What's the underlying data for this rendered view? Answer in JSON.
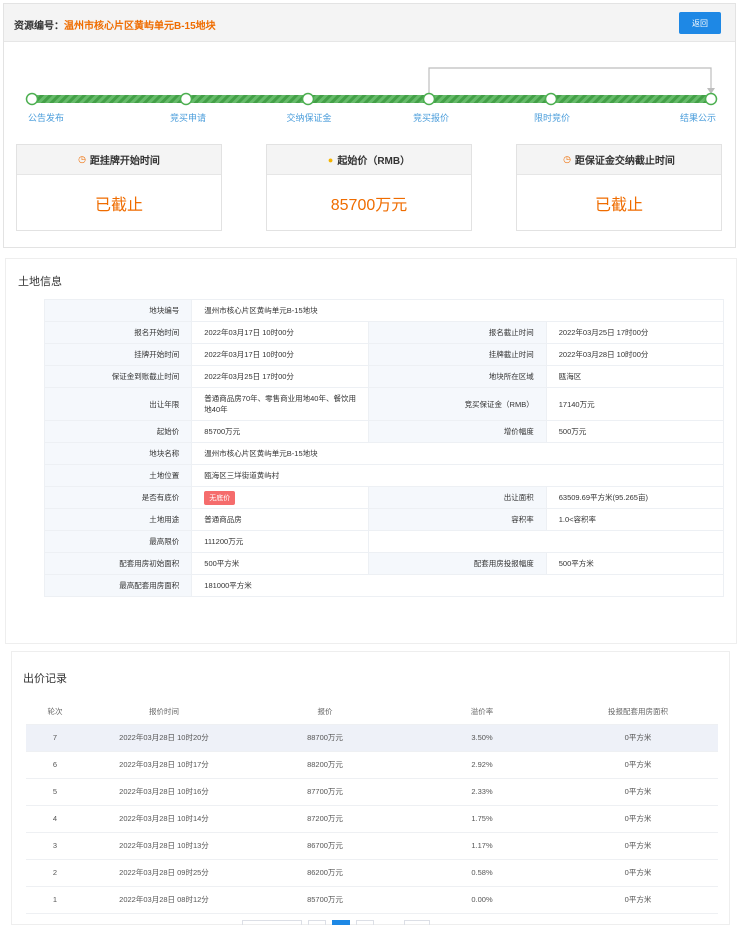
{
  "header": {
    "label": "资源编号：",
    "code": "温州市核心片区黄屿单元B-15地块",
    "back_label": "返回"
  },
  "steps": [
    {
      "label": "公告发布"
    },
    {
      "label": "竞买申请"
    },
    {
      "label": "交纳保证金"
    },
    {
      "label": "竞买报价"
    },
    {
      "label": "限时竞价"
    },
    {
      "label": "结果公示"
    }
  ],
  "cards": [
    {
      "title": "距挂牌开始时间",
      "value": "已截止",
      "icon": "clock-icon"
    },
    {
      "title": "起始价（RMB）",
      "value": "85700万元",
      "icon": "coin-icon"
    },
    {
      "title": "距保证金交纳截止时间",
      "value": "已截止",
      "icon": "clock-icon"
    }
  ],
  "land": {
    "title": "土地信息",
    "rows": {
      "r1": {
        "k": "地块编号",
        "v": "温州市核心片区黄屿单元B-15地块"
      },
      "r2": {
        "k": "报名开始时间",
        "v": "2022年03月17日 10时00分",
        "k2": "报名截止时间",
        "v2": "2022年03月25日 17时00分"
      },
      "r3": {
        "k": "挂牌开始时间",
        "v": "2022年03月17日 10时00分",
        "k2": "挂牌截止时间",
        "v2": "2022年03月28日 10时00分"
      },
      "r4": {
        "k": "保证金到账截止时间",
        "v": "2022年03月25日 17时00分",
        "k2": "地块所在区域",
        "v2": "瓯海区"
      },
      "r5": {
        "k": "出让年限",
        "v": "普通商品房70年、零售商业用地40年、餐饮用地40年",
        "k2": "竞买保证金（RMB）",
        "v2": "17140万元"
      },
      "r6": {
        "k": "起始价",
        "v": "85700万元",
        "k2": "增价幅度",
        "v2": "500万元"
      },
      "r7": {
        "k": "地块名称",
        "v": "温州市核心片区黄屿单元B-15地块"
      },
      "r8": {
        "k": "土地位置",
        "v": "瓯海区三垟街道黄屿村"
      },
      "r9": {
        "k": "是否有底价",
        "v": "无底价",
        "k2": "出让面积",
        "v2": "63509.69平方米(95.265亩)"
      },
      "r10": {
        "k": "土地用途",
        "v": "普通商品房",
        "k2": "容积率",
        "v2": "1.0<容积率"
      },
      "r11": {
        "k": "最高限价",
        "v": "111200万元"
      },
      "r12": {
        "k": "配套用房初始面积",
        "v": "500平方米",
        "k2": "配套用房投报幅度",
        "v2": "500平方米"
      },
      "r13": {
        "k": "最高配套用房面积",
        "v": "181000平方米"
      }
    }
  },
  "bids": {
    "title": "出价记录",
    "headers": [
      "轮次",
      "报价时间",
      "报价",
      "溢价率",
      "投报配套用房面积"
    ],
    "rows": [
      [
        "7",
        "2022年03月28日 10时20分",
        "88700万元",
        "3.50%",
        "0平方米"
      ],
      [
        "6",
        "2022年03月28日 10时17分",
        "88200万元",
        "2.92%",
        "0平方米"
      ],
      [
        "5",
        "2022年03月28日 10时16分",
        "87700万元",
        "2.33%",
        "0平方米"
      ],
      [
        "4",
        "2022年03月28日 10时14分",
        "87200万元",
        "1.75%",
        "0平方米"
      ],
      [
        "3",
        "2022年03月28日 10时13分",
        "86700万元",
        "1.17%",
        "0平方米"
      ],
      [
        "2",
        "2022年03月28日 09时25分",
        "86200万元",
        "0.58%",
        "0平方米"
      ],
      [
        "1",
        "2022年03月28日 08时12分",
        "85700万元",
        "0.00%",
        "0平方米"
      ]
    ]
  },
  "colors": {
    "accent": "#1e88e5",
    "highlight": "#ef6c00",
    "progress": "#4caf50"
  }
}
